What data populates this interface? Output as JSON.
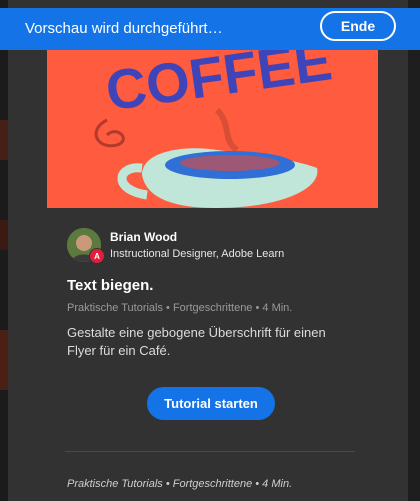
{
  "banner": {
    "title": "Vorschau wird durchgeführt…",
    "end_label": "Ende"
  },
  "hero": {
    "word": "COFFEE",
    "colors": {
      "background": "#ff5b3f",
      "text": "#3f45b8",
      "cup": "#bfe6d9",
      "coffee": "#2f6fd6"
    }
  },
  "author": {
    "name": "Brian Wood",
    "role": "Instructional Designer, Adobe Learn"
  },
  "tutorial": {
    "title": "Text biegen.",
    "meta": "Praktische Tutorials • Fortgeschrittene • 4 Min.",
    "description": "Gestalte eine gebogene Überschrift für einen Flyer für ein Café.",
    "start_label": "Tutorial starten"
  },
  "footer": {
    "meta": "Praktische Tutorials • Fortgeschrittene • 4 Min."
  }
}
